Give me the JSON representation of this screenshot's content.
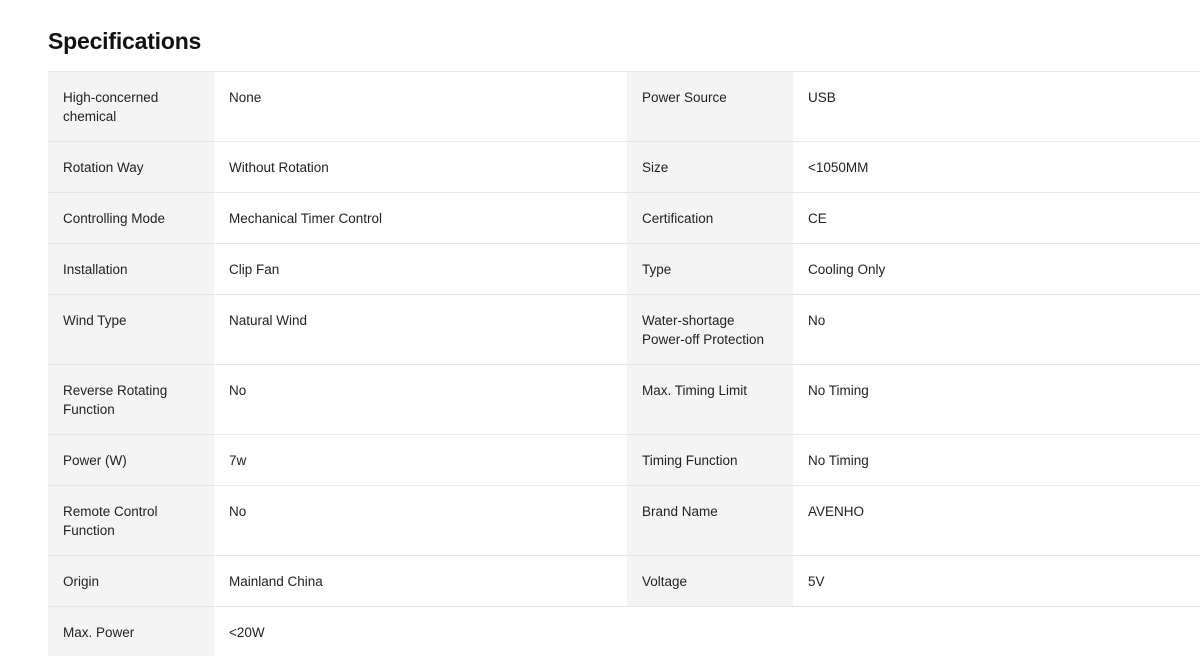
{
  "title": "Specifications",
  "rows": [
    {
      "left_label": "High-concerned chemical",
      "left_value": "None",
      "right_label": "Power Source",
      "right_value": "USB"
    },
    {
      "left_label": "Rotation Way",
      "left_value": "Without Rotation",
      "right_label": "Size",
      "right_value": "<1050MM"
    },
    {
      "left_label": "Controlling Mode",
      "left_value": "Mechanical Timer Control",
      "right_label": "Certification",
      "right_value": "CE"
    },
    {
      "left_label": "Installation",
      "left_value": "Clip Fan",
      "right_label": "Type",
      "right_value": "Cooling Only"
    },
    {
      "left_label": "Wind Type",
      "left_value": "Natural Wind",
      "right_label": "Water-shortage Power-off Protection",
      "right_value": "No"
    },
    {
      "left_label": "Reverse Rotating Function",
      "left_value": "No",
      "right_label": "Max. Timing Limit",
      "right_value": "No Timing"
    },
    {
      "left_label": "Power (W)",
      "left_value": "7w",
      "right_label": "Timing Function",
      "right_value": "No Timing"
    },
    {
      "left_label": "Remote Control Function",
      "left_value": "No",
      "right_label": "Brand Name",
      "right_value": "AVENHO"
    },
    {
      "left_label": "Origin",
      "left_value": "Mainland China",
      "right_label": "Voltage",
      "right_value": "5V"
    },
    {
      "left_label": "Max. Power",
      "left_value": "<20W",
      "right_label": "",
      "right_value": ""
    }
  ]
}
